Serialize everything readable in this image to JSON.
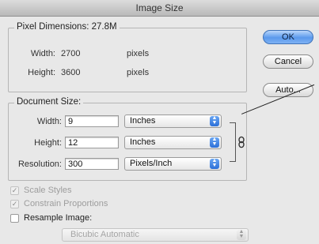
{
  "window": {
    "title": "Image Size"
  },
  "pixel_dimensions": {
    "label": "Pixel Dimensions:",
    "size": "27.8M",
    "width_label": "Width:",
    "width_value": "2700",
    "width_unit": "pixels",
    "height_label": "Height:",
    "height_value": "3600",
    "height_unit": "pixels"
  },
  "document_size": {
    "label": "Document Size:",
    "width_label": "Width:",
    "width_value": "9",
    "width_unit": "Inches",
    "height_label": "Height:",
    "height_value": "12",
    "height_unit": "Inches",
    "resolution_label": "Resolution:",
    "resolution_value": "300",
    "resolution_unit": "Pixels/Inch",
    "link_icon": "chain-link-icon"
  },
  "buttons": {
    "ok": "OK",
    "cancel": "Cancel",
    "auto": "Auto..."
  },
  "options": {
    "scale_styles": {
      "label": "Scale Styles",
      "checked": true,
      "enabled": false
    },
    "constrain_proportions": {
      "label": "Constrain Proportions",
      "checked": true,
      "enabled": false
    },
    "resample_image": {
      "label": "Resample Image:",
      "checked": false,
      "enabled": true
    },
    "resample_method": {
      "value": "Bicubic Automatic",
      "enabled": false
    }
  },
  "colors": {
    "accent": "#5a99ec",
    "stepper": "#2b6fd8"
  }
}
